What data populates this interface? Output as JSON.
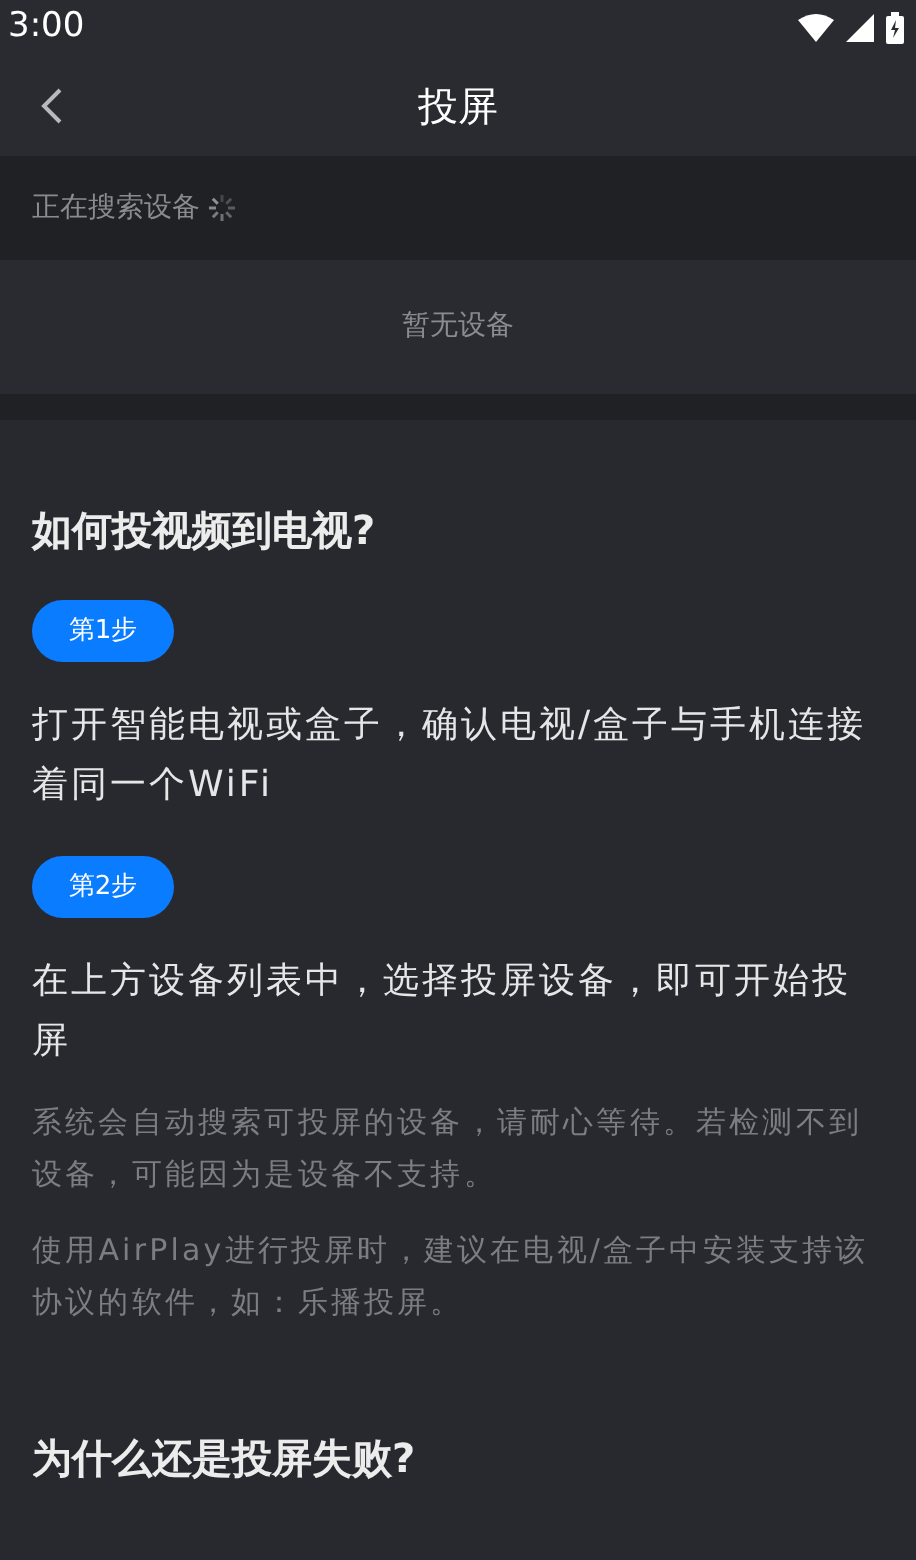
{
  "status_bar": {
    "time": "3:00"
  },
  "header": {
    "title": "投屏"
  },
  "search": {
    "label": "正在搜索设备",
    "searching": true
  },
  "devices": {
    "empty_text": "暂无设备"
  },
  "sections": [
    {
      "title": "如何投视频到电视?",
      "steps": [
        {
          "badge": "第1步",
          "text": "打开智能电视或盒子，确认电视/盒子与手机连接着同一个WiFi"
        },
        {
          "badge": "第2步",
          "text": "在上方设备列表中，选择投屏设备，即可开始投屏"
        }
      ],
      "notes": [
        "系统会自动搜索可投屏的设备，请耐心等待。若检测不到设备，可能因为是设备不支持。",
        "使用AirPlay进行投屏时，建议在电视/盒子中安装支持该协议的软件，如：乐播投屏。"
      ]
    },
    {
      "title": "为什么还是投屏失败?"
    }
  ]
}
